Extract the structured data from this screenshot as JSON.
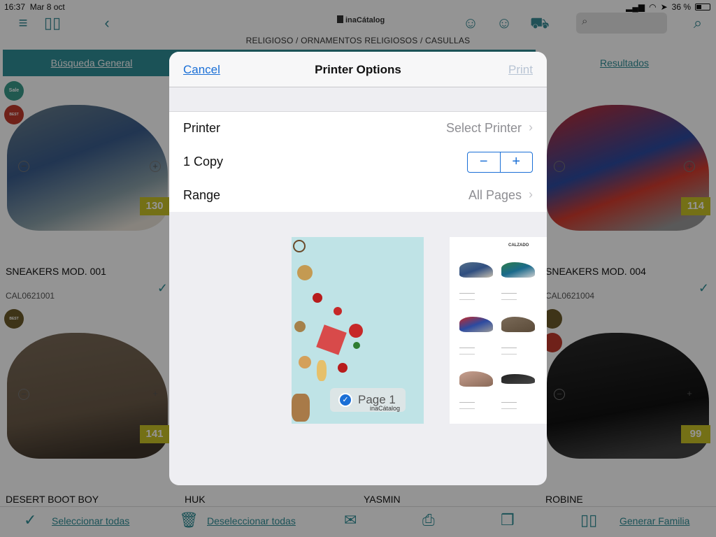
{
  "status": {
    "time": "16:37",
    "date": "Mar 8 oct",
    "battery": "36 %"
  },
  "app": {
    "logo": "inaCátalog"
  },
  "breadcrumb": "RELIGIOSO / ORNAMENTOS RELIGIOSOS / CASULLAS",
  "tabs": [
    {
      "label": "Búsqueda General"
    },
    {
      "label": ""
    },
    {
      "label": ""
    },
    {
      "label": "Resultados"
    }
  ],
  "products": [
    {
      "name": "SNEAKERS MOD. 001",
      "code": "CAL0621001",
      "price": "130"
    },
    {
      "name": "SNEAKERS MOD. 004",
      "code": "CAL0621004",
      "price": "114"
    },
    {
      "name": "DESERT BOOT BOY",
      "price": "141"
    },
    {
      "name": "ROBINE",
      "price": "99"
    },
    {
      "name": "HUK"
    },
    {
      "name": "YASMIN"
    }
  ],
  "badges": {
    "sale": "Sale",
    "best_seller": "BEST SELLER",
    "best_choice": "BEST CHOICE"
  },
  "bottombar": {
    "select_all": "Seleccionar todas",
    "deselect_all": "Deseleccionar todas",
    "generate_family": "Generar Familia"
  },
  "modal": {
    "cancel": "Cancel",
    "title": "Printer Options",
    "print": "Print",
    "printer_label": "Printer",
    "printer_value": "Select Printer",
    "copies_label": "1 Copy",
    "range_label": "Range",
    "range_value": "All Pages",
    "page1_label": "Page 1",
    "page1_logo": "inaCátalog",
    "page2_heading": "CALZADO"
  },
  "colors": {
    "accent": "#2f8d96",
    "ios_blue": "#1a6fd6",
    "price_tag": "#c9c226"
  }
}
